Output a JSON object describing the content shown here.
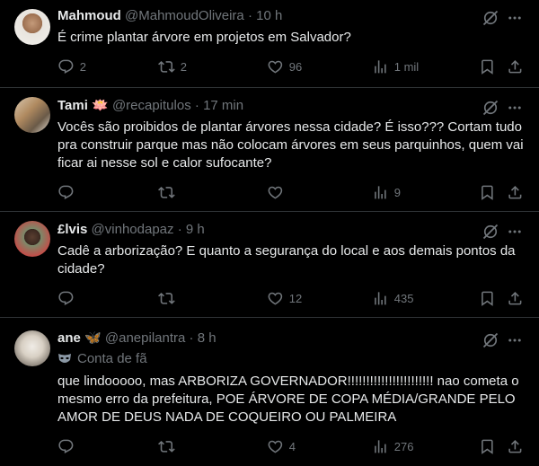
{
  "colors": {
    "background": "#000000",
    "text": "#e7e9ea",
    "muted": "#71767b",
    "divider": "#2f3336"
  },
  "tweets": [
    {
      "name": "Mahmoud",
      "emoji": "",
      "handle": "@MahmoudOliveira",
      "time": "10 h",
      "separator": "·",
      "text": "É crime plantar árvore em projetos em Salvador?",
      "replies": "2",
      "reposts": "2",
      "likes": "96",
      "views": "1 mil"
    },
    {
      "name": "Tami",
      "emoji": "🪷",
      "handle": "@recapitulos",
      "time": "17 min",
      "separator": "·",
      "text": "Vocês são proibidos de plantar árvores nessa cidade? É isso??? Cortam tudo pra construir parque mas não colocam árvores em seus parquinhos, quem vai ficar ai nesse sol e calor sufocante?",
      "replies": "",
      "reposts": "",
      "likes": "",
      "views": "9"
    },
    {
      "name": "£lvis",
      "emoji": "",
      "handle": "@vinhodapaz",
      "time": "9 h",
      "separator": "·",
      "text": "Cadê a arborização? E quanto a segurança do local e aos demais pontos da cidade?",
      "replies": "",
      "reposts": "",
      "likes": "12",
      "views": "435"
    },
    {
      "name": "ane",
      "emoji": "🦋",
      "handle": "@anepilantra",
      "time": "8 h",
      "separator": "·",
      "fan_badge": "Conta de fã",
      "text": "que lindooooo, mas ARBORIZA GOVERNADOR!!!!!!!!!!!!!!!!!!!!!!! nao cometa o mesmo erro da prefeitura, POE ÁRVORE DE COPA MÉDIA/GRANDE PELO AMOR DE DEUS NADA DE COQUEIRO OU PALMEIRA",
      "replies": "",
      "reposts": "",
      "likes": "4",
      "views": "276"
    }
  ],
  "icons": [
    "reply-icon",
    "repost-icon",
    "like-icon",
    "views-icon",
    "bookmark-icon",
    "share-icon",
    "grok-icon",
    "more-icon",
    "mask-icon"
  ]
}
